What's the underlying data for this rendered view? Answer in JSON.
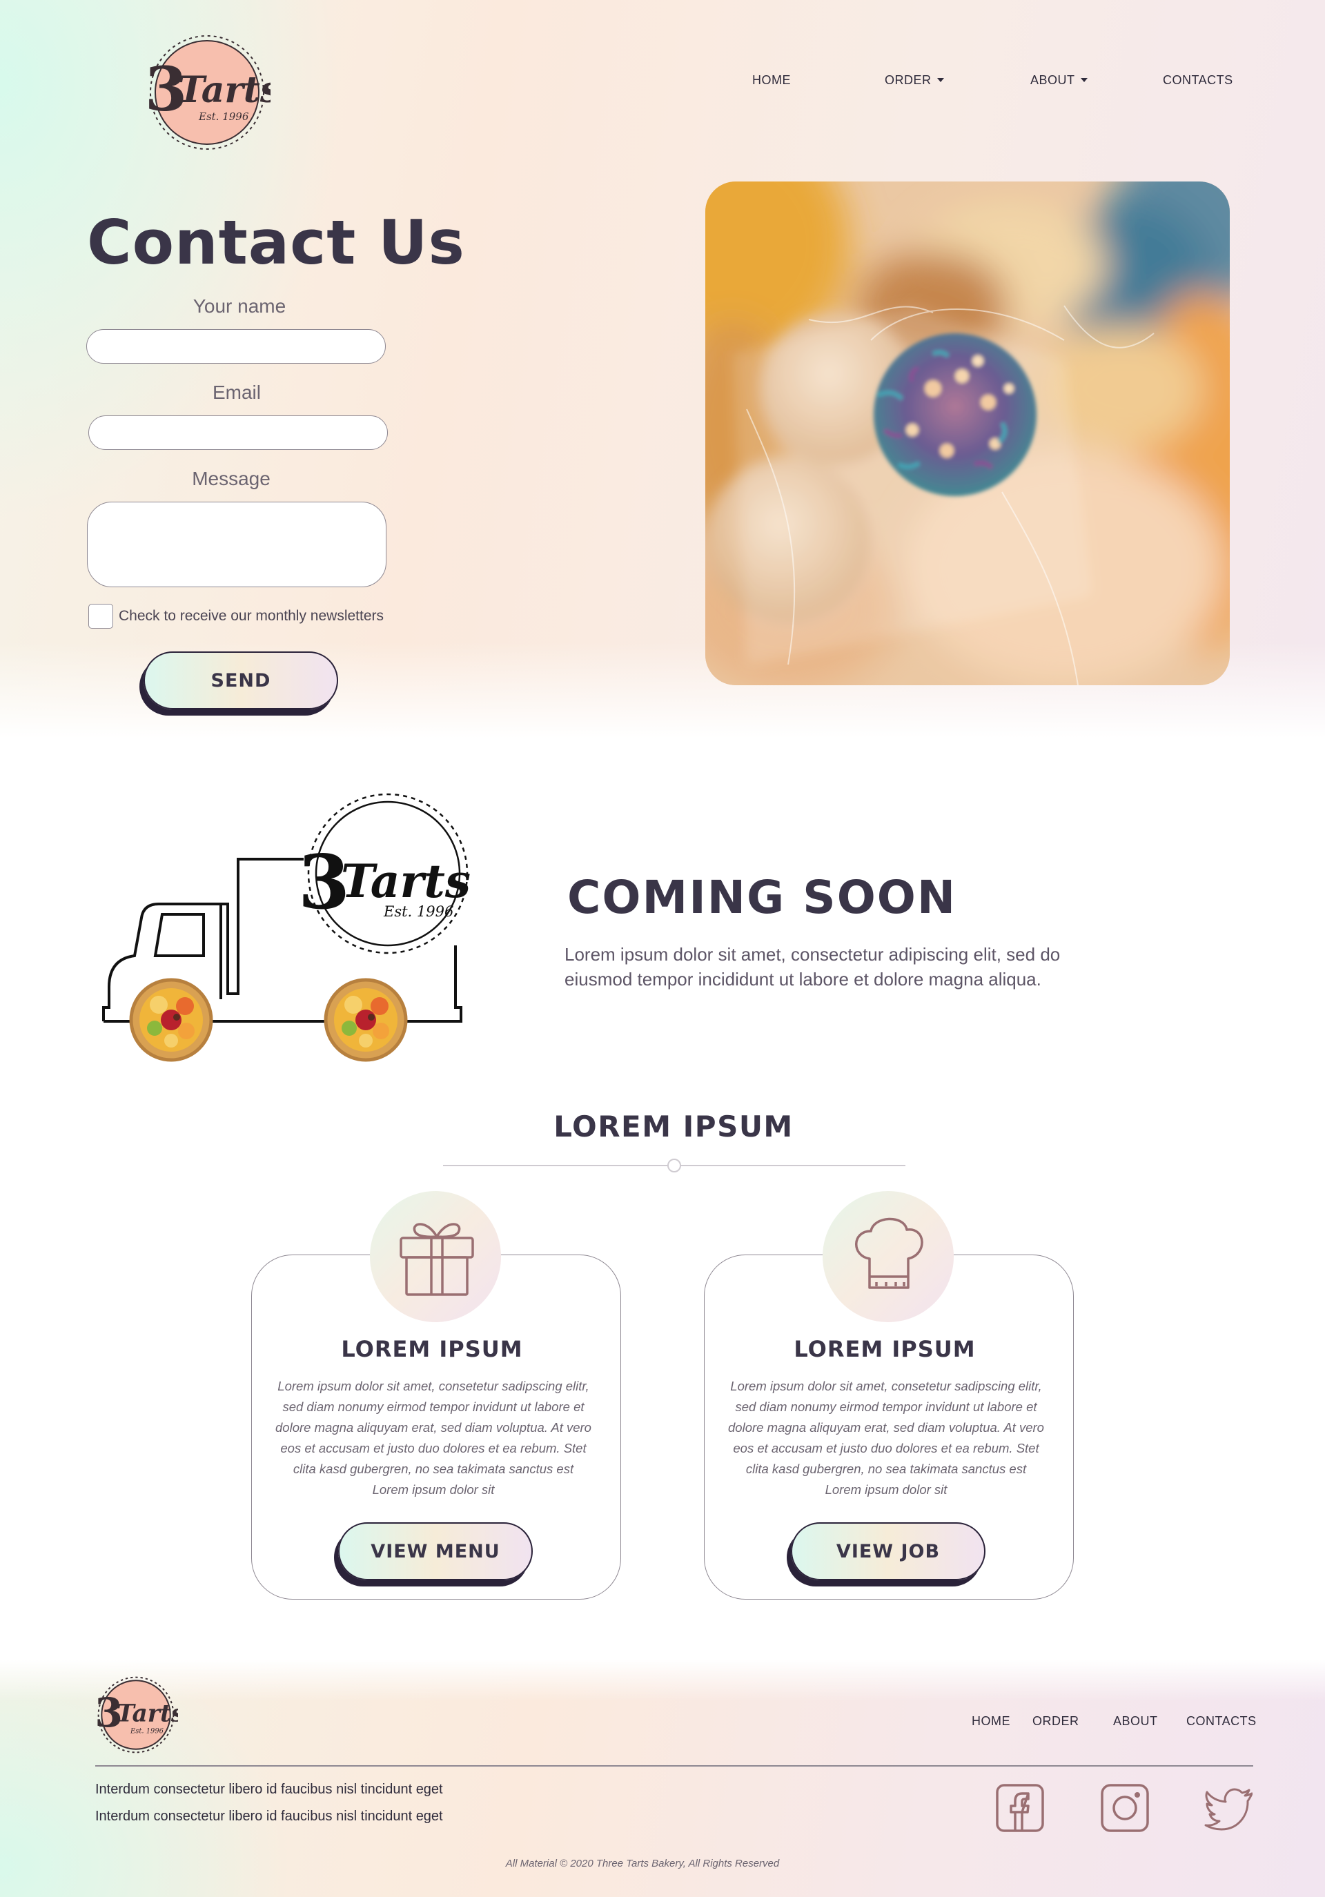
{
  "brand": {
    "logo_number": "3",
    "logo_name": "Tarts",
    "logo_est": "Est. 1996",
    "logo_fill": "#f7bfae",
    "logo_ink": "#3a2e33"
  },
  "nav": {
    "home": "HOME",
    "order": "ORDER",
    "about": "ABOUT",
    "contacts": "CONTACTS"
  },
  "contact": {
    "title": "Contact Us",
    "name_label": "Your name",
    "email_label": "Email",
    "message_label": "Message",
    "name_value": "",
    "email_value": "",
    "message_value": "",
    "newsletter_label": "Check to receive our monthly newsletters",
    "newsletter_checked": false,
    "send_label": "SEND"
  },
  "coming_soon": {
    "title": "COMING SOON",
    "text": "Lorem ipsum dolor sit amet, consectetur adipiscing elit, sed do eiusmod tempor incididunt ut labore et dolore magna aliqua."
  },
  "section": {
    "title": "LOREM IPSUM",
    "cards": [
      {
        "icon": "gift-icon",
        "title": "LOREM IPSUM",
        "text": "Lorem ipsum dolor sit amet, consetetur sadipscing elitr, sed diam nonumy eirmod tempor invidunt ut labore et dolore magna aliquyam erat, sed diam voluptua. At vero eos et accusam et justo duo dolores et ea rebum. Stet clita kasd gubergren, no sea takimata sanctus est Lorem ipsum dolor sit",
        "button": "VIEW MENU"
      },
      {
        "icon": "chef-hat-icon",
        "title": "LOREM IPSUM",
        "text": "Lorem ipsum dolor sit amet, consetetur sadipscing elitr, sed diam nonumy eirmod tempor invidunt ut labore et dolore magna aliquyam erat, sed diam voluptua. At vero eos et accusam et justo duo dolores et ea rebum. Stet clita kasd gubergren, no sea takimata sanctus est Lorem ipsum dolor sit",
        "button": "VIEW JOB"
      }
    ]
  },
  "footer": {
    "nav": [
      "HOME",
      "ORDER",
      "ABOUT",
      "CONTACTS"
    ],
    "line1": "Interdum consectetur libero id faucibus nisl tincidunt eget",
    "line2": "Interdum consectetur libero id faucibus nisl tincidunt eget",
    "social": [
      "facebook-icon",
      "instagram-icon",
      "twitter-icon"
    ],
    "copyright": "All Material © 2020 Three Tarts  Bakery, All Rights Reserved"
  },
  "colors": {
    "ink": "#3a3548",
    "icon_stroke": "#9a6f72",
    "button_shadow": "#2a2239"
  }
}
